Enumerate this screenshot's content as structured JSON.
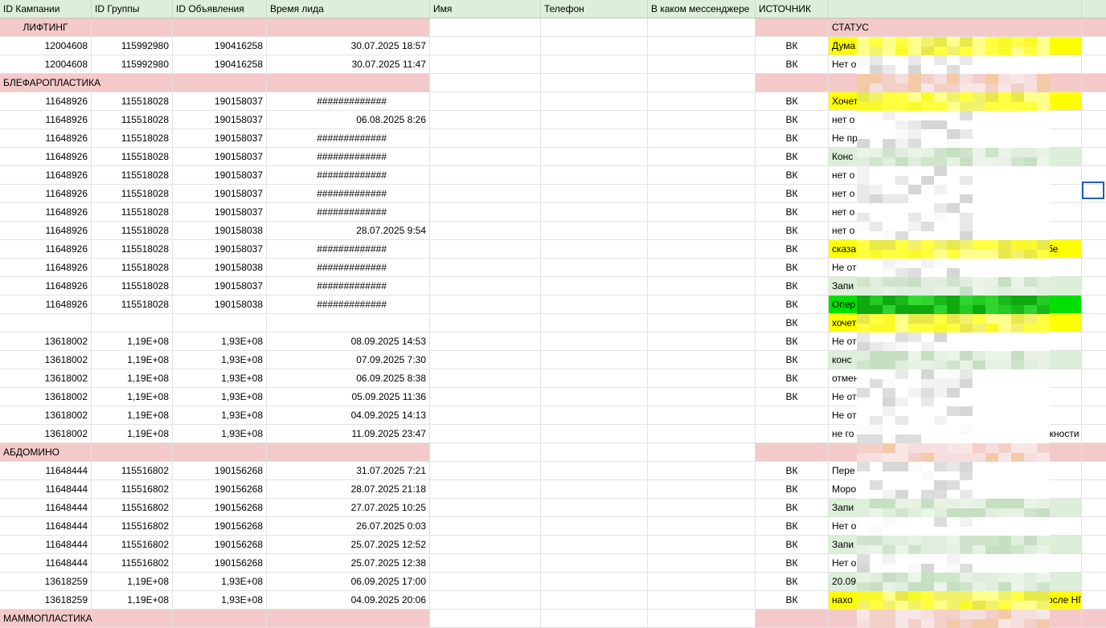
{
  "columns": [
    {
      "key": "campaign",
      "label": "ID Кампании"
    },
    {
      "key": "group",
      "label": "ID Группы"
    },
    {
      "key": "ad",
      "label": "ID Объявления"
    },
    {
      "key": "time",
      "label": "Время лида"
    },
    {
      "key": "name",
      "label": "Имя"
    },
    {
      "key": "phone",
      "label": "Телефон"
    },
    {
      "key": "messenger",
      "label": "В каком мессенджере"
    },
    {
      "key": "source",
      "label": "ИСТОЧНИК"
    },
    {
      "key": "status",
      "label": ""
    },
    {
      "key": "extra",
      "label": ""
    }
  ],
  "rows": [
    {
      "type": "section",
      "campaign": "ЛИФТИНГ",
      "campaign_align": "center",
      "status": "СТАТУС",
      "status_section": true
    },
    {
      "campaign": "12004608",
      "group": "115992980",
      "ad": "190416258",
      "time": "30.07.2025 18:57",
      "source": "ВК",
      "status": "Дума",
      "status_hl": "y"
    },
    {
      "campaign": "12004608",
      "group": "115992980",
      "ad": "190416258",
      "time": "30.07.2025 11:47",
      "source": "ВК",
      "status": "Нет о"
    },
    {
      "type": "section",
      "campaign": "БЛЕФАРОПЛАСТИКА",
      "campaign_align": "left"
    },
    {
      "campaign": "11648926",
      "group": "115518028",
      "ad": "190158037",
      "time": "#############",
      "time_hash": true,
      "source": "ВК",
      "status": "Хочет",
      "status_hl": "y"
    },
    {
      "campaign": "11648926",
      "group": "115518028",
      "ad": "190158037",
      "time": "06.08.2025 8:26",
      "source": "ВК",
      "status": "нет о"
    },
    {
      "campaign": "11648926",
      "group": "115518028",
      "ad": "190158037",
      "time": "#############",
      "time_hash": true,
      "source": "ВК",
      "status": "Не пр"
    },
    {
      "campaign": "11648926",
      "group": "115518028",
      "ad": "190158037",
      "time": "#############",
      "time_hash": true,
      "source": "ВК",
      "status": "Конс",
      "status_hl": "g"
    },
    {
      "campaign": "11648926",
      "group": "115518028",
      "ad": "190158037",
      "time": "#############",
      "time_hash": true,
      "source": "ВК",
      "status": "нет о"
    },
    {
      "campaign": "11648926",
      "group": "115518028",
      "ad": "190158037",
      "time": "#############",
      "time_hash": true,
      "source": "ВК",
      "status": "нет о"
    },
    {
      "campaign": "11648926",
      "group": "115518028",
      "ad": "190158037",
      "time": "#############",
      "time_hash": true,
      "source": "ВК",
      "status": "нет о"
    },
    {
      "campaign": "11648926",
      "group": "115518028",
      "ad": "190158038",
      "time": "28.07.2025 9:54",
      "source": "ВК",
      "status": "нет о"
    },
    {
      "campaign": "11648926",
      "group": "115518028",
      "ad": "190158037",
      "time": "#############",
      "time_hash": true,
      "source": "ВК",
      "status": "сказа",
      "status_tail": "бе",
      "status_hl": "y"
    },
    {
      "campaign": "11648926",
      "group": "115518028",
      "ad": "190158038",
      "time": "#############",
      "time_hash": true,
      "source": "ВК",
      "status": "Не от"
    },
    {
      "campaign": "11648926",
      "group": "115518028",
      "ad": "190158037",
      "time": "#############",
      "time_hash": true,
      "source": "ВК",
      "status": "Запи",
      "status_hl": "g"
    },
    {
      "campaign": "11648926",
      "group": "115518028",
      "ad": "190158038",
      "time": "#############",
      "time_hash": true,
      "source": "ВК",
      "status": "Опер",
      "status_hl": "G"
    },
    {
      "campaign": "",
      "group": "",
      "ad": "",
      "time": "",
      "source": "ВК",
      "status": "хочет",
      "status_hl": "y"
    },
    {
      "campaign": "13618002",
      "group": "1,19E+08",
      "ad": "1,93E+08",
      "time": "08.09.2025 14:53",
      "source": "ВК",
      "status": "Не от"
    },
    {
      "campaign": "13618002",
      "group": "1,19E+08",
      "ad": "1,93E+08",
      "time": "07.09.2025 7:30",
      "source": "ВК",
      "status": "конс",
      "status_hl": "g"
    },
    {
      "campaign": "13618002",
      "group": "1,19E+08",
      "ad": "1,93E+08",
      "time": "06.09.2025 8:38",
      "source": "ВК",
      "status": "отмен"
    },
    {
      "campaign": "13618002",
      "group": "1,19E+08",
      "ad": "1,93E+08",
      "time": "05.09.2025 11:36",
      "source": "ВК",
      "status": "Не от"
    },
    {
      "campaign": "13618002",
      "group": "1,19E+08",
      "ad": "1,93E+08",
      "time": "04.09.2025 14:13",
      "source": "",
      "status": "Не от"
    },
    {
      "campaign": "13618002",
      "group": "1,19E+08",
      "ad": "1,93E+08",
      "time": "11.09.2025 23:47",
      "source": "",
      "status": "не го",
      "status_tail": "жности"
    },
    {
      "type": "section",
      "campaign": "АБДОМИНО",
      "campaign_align": "left"
    },
    {
      "campaign": "11648444",
      "group": "115516802",
      "ad": "190156268",
      "time": "31.07.2025 7:21",
      "source": "ВК",
      "status": "Пере"
    },
    {
      "campaign": "11648444",
      "group": "115516802",
      "ad": "190156268",
      "time": "28.07.2025 21:18",
      "source": "ВК",
      "status": "Моро"
    },
    {
      "campaign": "11648444",
      "group": "115516802",
      "ad": "190156268",
      "time": "27.07.2025 10:25",
      "source": "ВК",
      "status": "Запи",
      "status_hl": "g"
    },
    {
      "campaign": "11648444",
      "group": "115516802",
      "ad": "190156268",
      "time": "26.07.2025 0:03",
      "source": "ВК",
      "status": "Нет о"
    },
    {
      "campaign": "11648444",
      "group": "115516802",
      "ad": "190156268",
      "time": "25.07.2025 12:52",
      "source": "ВК",
      "status": "Запи",
      "status_hl": "g"
    },
    {
      "campaign": "11648444",
      "group": "115516802",
      "ad": "190156268",
      "time": "25.07.2025 12:38",
      "source": "ВК",
      "status": "Нет о"
    },
    {
      "campaign": "13618259",
      "group": "1,19E+08",
      "ad": "1,93E+08",
      "time": "06.09.2025 17:00",
      "source": "ВК",
      "status": "20.09",
      "status_hl": "g"
    },
    {
      "campaign": "13618259",
      "group": "1,19E+08",
      "ad": "1,93E+08",
      "time": "04.09.2025 20:06",
      "source": "ВК",
      "status": "нахо",
      "status_tail": "осле НГ",
      "status_hl": "y"
    },
    {
      "type": "section",
      "campaign": "МАММОПЛАСТИКА",
      "campaign_align": "left"
    }
  ],
  "colors": {
    "header_bg": "#dcefd9",
    "section_bg": "#f4c9c9",
    "highlight_yellow": "#ffff00",
    "highlight_green": "#dcefd9",
    "highlight_bright_green": "#00e000",
    "selection": "#1f5fbf"
  }
}
